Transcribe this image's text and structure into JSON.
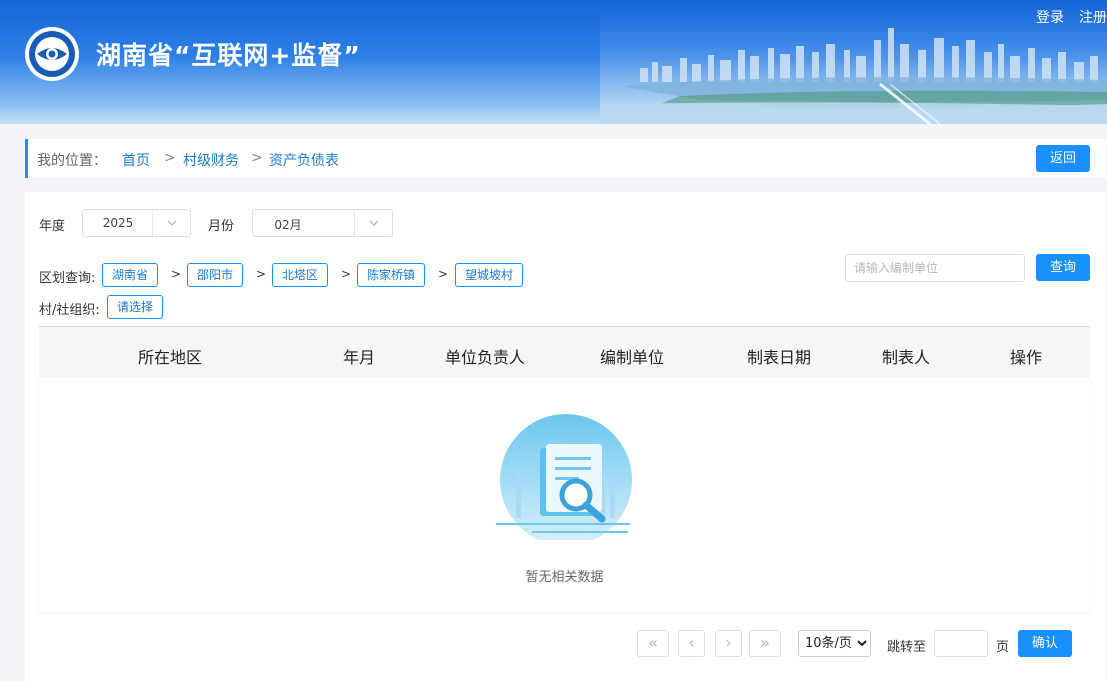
{
  "header": {
    "title": "湖南省“互联网+监督”",
    "login": "登录",
    "register": "注册",
    "logo_icon": "eye-seal-icon",
    "banner_image": "city-skyline"
  },
  "breadcrumb": {
    "label": "我的位置：",
    "items": [
      "首页",
      "村级财务",
      "资产负债表"
    ],
    "separator": ">",
    "back": "返回"
  },
  "filters": {
    "year_label": "年度",
    "year_value": "2025",
    "month_label": "月份",
    "month_value": "02月",
    "region_label": "区划查询:",
    "regions": [
      "湖南省",
      "邵阳市",
      "北塔区",
      "陈家桥镇",
      "望城坡村"
    ],
    "region_separator": ">",
    "org_label": "村/社组织:",
    "org_button": "请选择",
    "search_placeholder": "请输入编制单位",
    "query": "查询"
  },
  "table": {
    "columns": [
      "所在地区",
      "年月",
      "单位负责人",
      "编制单位",
      "制表日期",
      "制表人",
      "操作"
    ],
    "rows": [],
    "empty_text": "暂无相关数据",
    "empty_icon": "document-search-icon"
  },
  "pagination": {
    "first": "«",
    "prev": "‹",
    "next": "›",
    "last": "»",
    "page_size": "10条/页",
    "page_size_options": [
      "10条/页"
    ],
    "jump_label": "跳转至",
    "page_unit": "页",
    "confirm": "确认"
  },
  "colors": {
    "primary": "#1890ff",
    "link": "#1a7bd4",
    "header_top": "#1466d6"
  }
}
